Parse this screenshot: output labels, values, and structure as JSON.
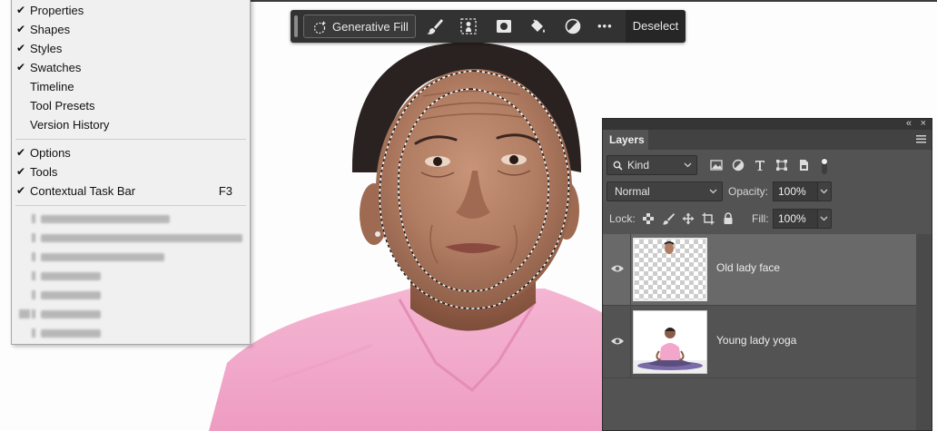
{
  "window_menu": {
    "items": [
      {
        "label": "Properties",
        "checked": true
      },
      {
        "label": "Shapes",
        "checked": true
      },
      {
        "label": "Styles",
        "checked": true
      },
      {
        "label": "Swatches",
        "checked": true
      },
      {
        "label": "Timeline",
        "checked": false
      },
      {
        "label": "Tool Presets",
        "checked": false
      },
      {
        "label": "Version History",
        "checked": false
      }
    ],
    "group2": [
      {
        "label": "Options",
        "checked": true
      },
      {
        "label": "Tools",
        "checked": true
      },
      {
        "label": "Contextual Task Bar",
        "checked": true,
        "shortcut": "F3"
      }
    ],
    "check_glyph": "✔"
  },
  "task_bar": {
    "generative_fill_label": "Generative Fill",
    "icons": [
      "brush-icon",
      "select-subject-icon",
      "mask-icon",
      "paint-bucket-icon",
      "adjustment-icon",
      "more-options-icon"
    ],
    "more_glyph": "•••",
    "deselect_label": "Deselect"
  },
  "layers_panel": {
    "collapse_glyph": "«",
    "close_glyph": "×",
    "tab_label": "Layers",
    "filter": {
      "search_glyph": "🔍",
      "kind_label": "Kind"
    },
    "blend_mode": "Normal",
    "opacity_label": "Opacity:",
    "opacity_value": "100%",
    "lock_label": "Lock:",
    "fill_label": "Fill:",
    "fill_value": "100%",
    "layers": [
      {
        "name": "Old lady face",
        "visible": true,
        "selected": true
      },
      {
        "name": "Young lady yoga",
        "visible": true,
        "selected": false
      }
    ]
  },
  "colors": {
    "panel_bg": "#535353",
    "task_bar_bg": "#323232",
    "menu_bg": "#f0f0f0",
    "selected_layer": "#696969",
    "shirt_pink": "#f2a6c9"
  }
}
